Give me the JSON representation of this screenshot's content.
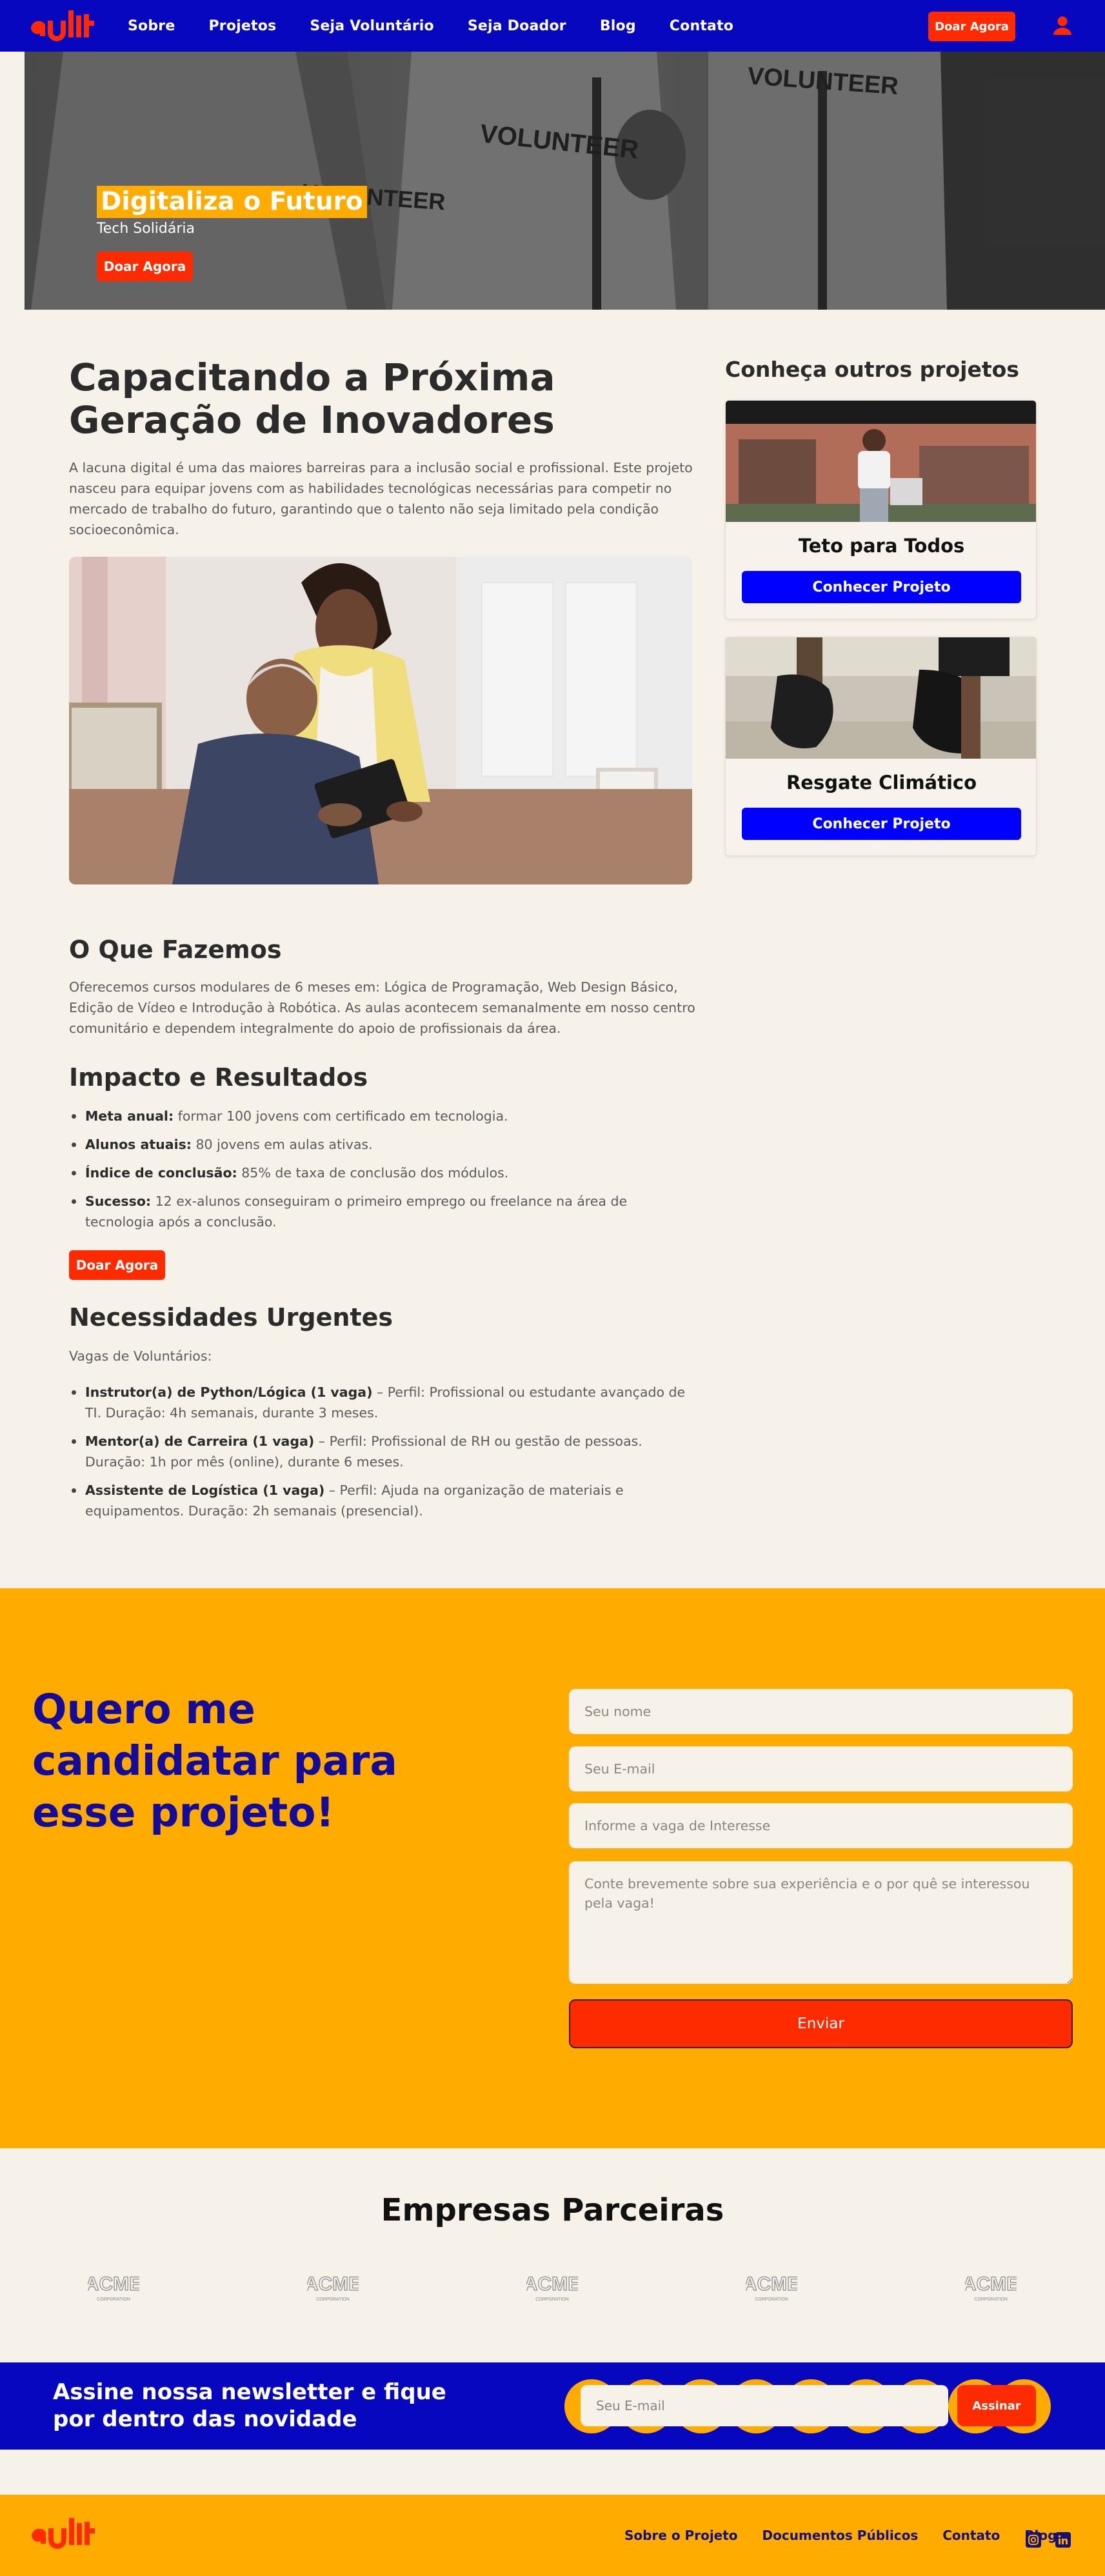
{
  "nav": {
    "links": [
      "Sobre",
      "Projetos",
      "Seja Voluntário",
      "Seja Doador",
      "Blog",
      "Contato"
    ],
    "donate_label": "Doar Agora"
  },
  "hero": {
    "title": "Digitaliza o Futuro",
    "subtitle": "Tech Solidária",
    "button": "Doar Agora",
    "shirt_text": "VOLUNTEER"
  },
  "main": {
    "title": "Capacitando a Próxima Geração de Inovadores",
    "intro": "A lacuna digital é uma das maiores barreiras para a inclusão social e profissional. Este projeto nasceu para equipar jovens com as habilidades tecnológicas necessárias para competir no mercado de trabalho do futuro, garantindo que o talento não seja limitado pela condição socioeconômica.",
    "what_title": "O Que Fazemos",
    "what_text": "Oferecemos cursos modulares de 6 meses em: Lógica de Programação, Web Design Básico, Edição de Vídeo e Introdução à Robótica. As aulas acontecem semanalmente em nosso centro comunitário e dependem integralmente do apoio de profissionais da área.",
    "impact_title": "Impacto e Resultados",
    "impact": [
      {
        "label": "Meta anual:",
        "text": " formar 100 jovens com certificado em tecnologia."
      },
      {
        "label": "Alunos atuais:",
        "text": " 80 jovens em aulas ativas."
      },
      {
        "label": "Índice de conclusão:",
        "text": " 85% de taxa de conclusão dos módulos."
      },
      {
        "label": "Sucesso:",
        "text": " 12 ex-alunos conseguiram o primeiro emprego ou freelance na área de tecnologia após a conclusão."
      }
    ],
    "impact_button": "Doar Agora",
    "needs_title": "Necessidades Urgentes",
    "needs_sub": "Vagas de Voluntários:",
    "needs": [
      {
        "label": "Instrutor(a) de Python/Lógica (1 vaga)",
        "text": " – Perfil: Profissional ou estudante avançado de TI. Duração: 4h semanais, durante 3 meses."
      },
      {
        "label": "Mentor(a) de Carreira (1 vaga)",
        "text": " – Perfil: Profissional de RH ou gestão de pessoas. Duração: 1h por mês (online), durante 6 meses."
      },
      {
        "label": "Assistente de Logística (1 vaga)",
        "text": " – Perfil: Ajuda na organização de materiais e equipamentos. Duração: 2h semanais (presencial)."
      }
    ]
  },
  "sidebar": {
    "title": "Conheça outros projetos",
    "cards": [
      {
        "title": "Teto para Todos",
        "button": "Conhecer Projeto"
      },
      {
        "title": "Resgate Climático",
        "button": "Conhecer Projeto"
      }
    ]
  },
  "apply": {
    "title": "Quero me candidatar para esse projeto!",
    "name_placeholder": "Seu nome",
    "email_placeholder": "Seu E-mail",
    "role_placeholder": "Informe a vaga de Interesse",
    "message_placeholder": "Conte brevemente sobre sua experiência e o por quê se interessou pela vaga!",
    "submit": "Enviar"
  },
  "partners": {
    "title": "Empresas Parceiras",
    "logos": [
      "ACME",
      "ACME",
      "ACME",
      "ACME",
      "ACME"
    ],
    "logo_sub": "CORPORATION"
  },
  "newsletter": {
    "title": "Assine nossa newsletter e fique por dentro das novidade",
    "placeholder": "Seu E-mail",
    "button": "Assinar"
  },
  "footer": {
    "links": [
      "Sobre o Projeto",
      "Documentos Públicos",
      "Contato",
      "Blog"
    ],
    "social": [
      "instagram-icon",
      "linkedin-icon"
    ]
  },
  "colors": {
    "blue": "#0807c0",
    "orange": "#ffab00",
    "red": "#ff2b00",
    "cream": "#f6f1e9",
    "navy": "#140b9b"
  }
}
